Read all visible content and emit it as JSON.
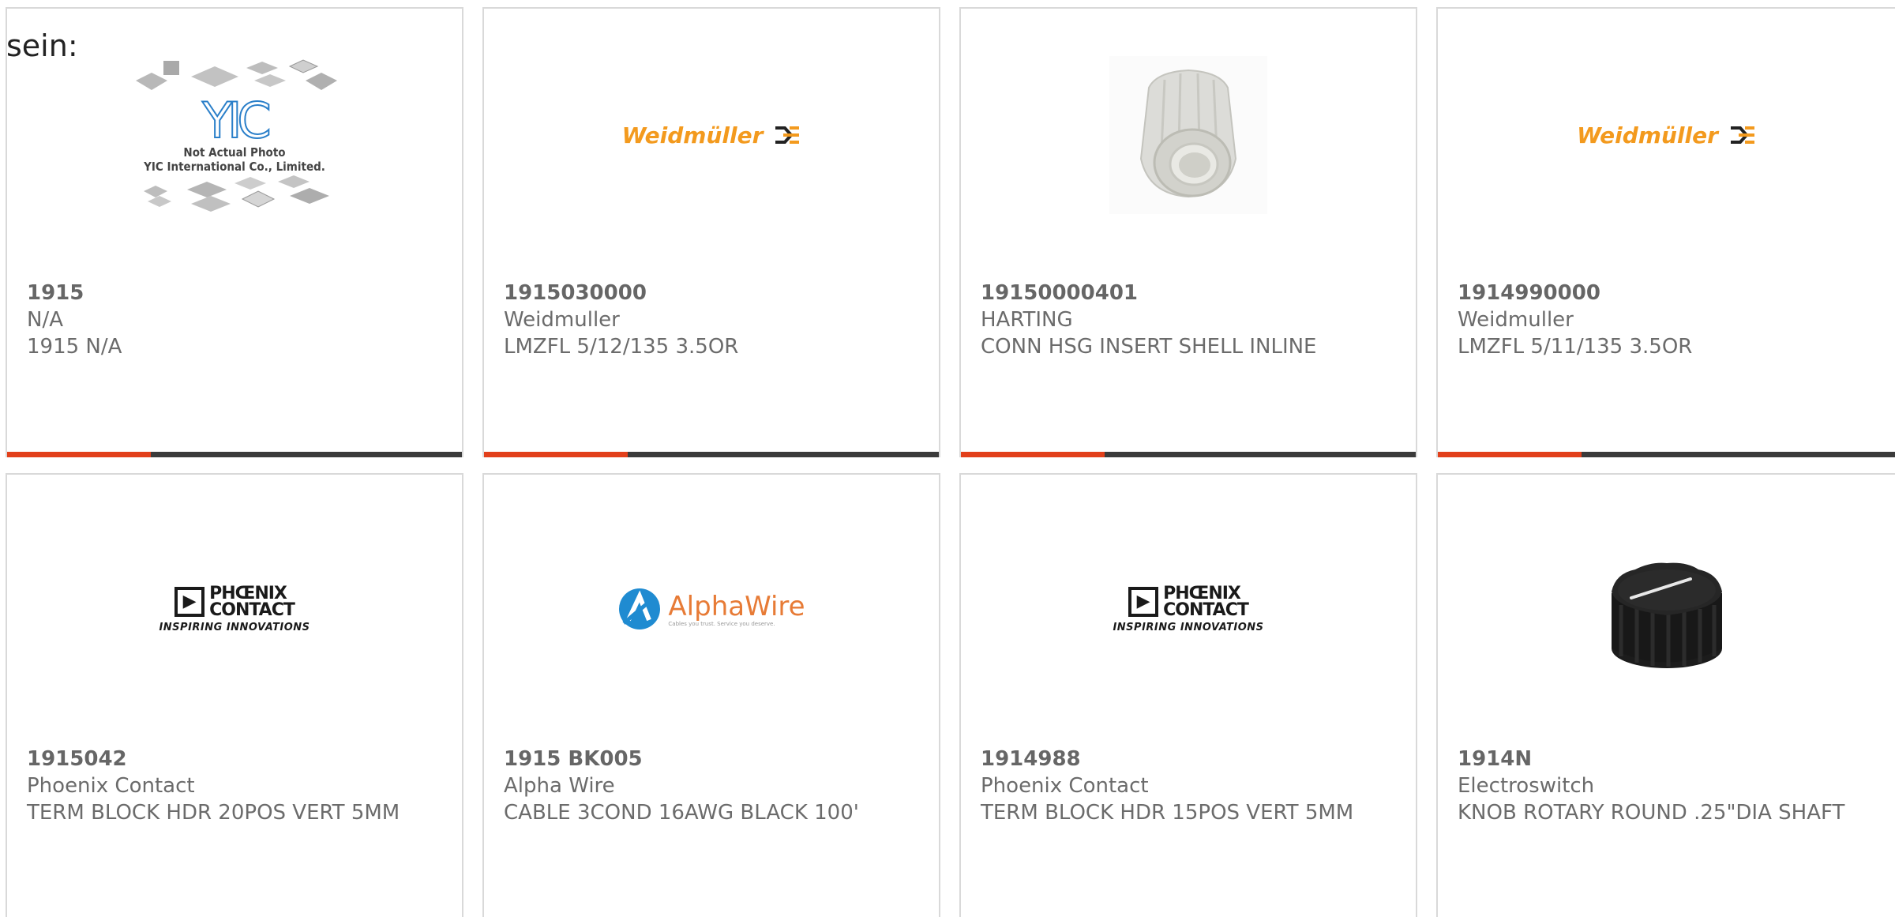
{
  "intro_text": "sein:",
  "colors": {
    "accent": "#e2401b",
    "bar": "#3b3b3b",
    "border": "#d9d9d9",
    "text": "#6b6b6b"
  },
  "cards": [
    {
      "part_number": "1915",
      "manufacturer": "N/A",
      "description": "1915 N/A",
      "image": "yic-placeholder",
      "image_caption_1": "Not Actual Photo",
      "image_caption_2": "YIC International Co., Limited.",
      "logo_text": "YIC"
    },
    {
      "part_number": "1915030000",
      "manufacturer": "Weidmuller",
      "description": "LMZFL 5/12/135 3.5OR",
      "image": "weidmuller-logo",
      "logo_text": "Weidmüller"
    },
    {
      "part_number": "19150000401",
      "manufacturer": "HARTING",
      "description": "CONN HSG INSERT SHELL INLINE",
      "image": "connector-housing-photo"
    },
    {
      "part_number": "1914990000",
      "manufacturer": "Weidmuller",
      "description": "LMZFL 5/11/135 3.5OR",
      "image": "weidmuller-logo",
      "logo_text": "Weidmüller"
    },
    {
      "part_number": "1915042",
      "manufacturer": "Phoenix Contact",
      "description": "TERM BLOCK HDR 20POS VERT 5MM",
      "image": "phoenix-contact-logo",
      "logo_line_1": "PHŒNIX",
      "logo_line_2": "CONTACT",
      "logo_tagline": "INSPIRING INNOVATIONS"
    },
    {
      "part_number": "1915 BK005",
      "manufacturer": "Alpha Wire",
      "description": "CABLE 3COND 16AWG BLACK 100'",
      "image": "alphawire-logo",
      "logo_text": "AlphaWire",
      "logo_tagline": "Cables you trust. Service you deserve."
    },
    {
      "part_number": "1914988",
      "manufacturer": "Phoenix Contact",
      "description": "TERM BLOCK HDR 15POS VERT 5MM",
      "image": "phoenix-contact-logo",
      "logo_line_1": "PHŒNIX",
      "logo_line_2": "CONTACT",
      "logo_tagline": "INSPIRING INNOVATIONS"
    },
    {
      "part_number": "1914N",
      "manufacturer": "Electroswitch",
      "description": "KNOB ROTARY ROUND .25\"DIA SHAFT",
      "image": "rotary-knob-photo"
    }
  ]
}
